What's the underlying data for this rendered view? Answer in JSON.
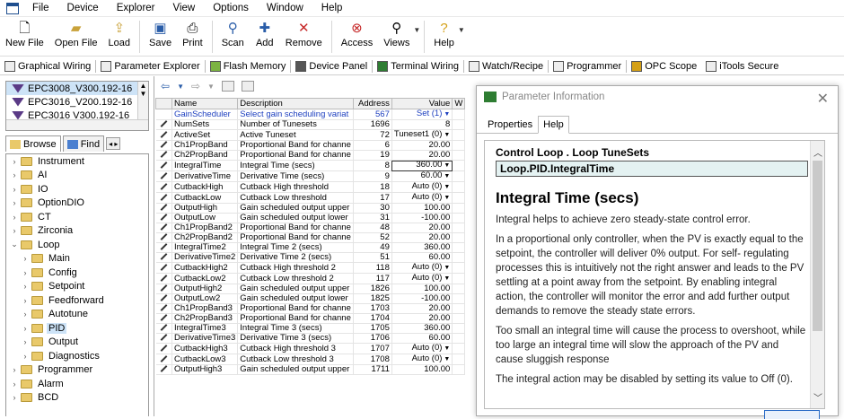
{
  "menu": {
    "items": [
      "File",
      "Device",
      "Explorer",
      "View",
      "Options",
      "Window",
      "Help"
    ]
  },
  "toolbar": {
    "new_file": "New File",
    "open_file": "Open File",
    "load": "Load",
    "save": "Save",
    "print": "Print",
    "scan": "Scan",
    "add": "Add",
    "remove": "Remove",
    "access": "Access",
    "views": "Views",
    "help": "Help"
  },
  "subtoolbar": {
    "items": [
      "Graphical Wiring",
      "Parameter Explorer",
      "Flash Memory",
      "Device Panel",
      "Terminal Wiring",
      "Watch/Recipe",
      "Programmer",
      "OPC Scope",
      "iTools Secure"
    ]
  },
  "devices": [
    "EPC3008_V300.192-16",
    "EPC3016_V200.192-16",
    "EPC3016 V300.192-16"
  ],
  "tabs": {
    "browse": "Browse",
    "find": "Find"
  },
  "tree": [
    {
      "label": "Instrument",
      "indent": 0,
      "expanded": false
    },
    {
      "label": "AI",
      "indent": 0,
      "expanded": false
    },
    {
      "label": "IO",
      "indent": 0,
      "expanded": false
    },
    {
      "label": "OptionDIO",
      "indent": 0,
      "expanded": false
    },
    {
      "label": "CT",
      "indent": 0,
      "expanded": false
    },
    {
      "label": "Zirconia",
      "indent": 0,
      "expanded": false
    },
    {
      "label": "Loop",
      "indent": 0,
      "expanded": true
    },
    {
      "label": "Main",
      "indent": 1,
      "expanded": false
    },
    {
      "label": "Config",
      "indent": 1,
      "expanded": false
    },
    {
      "label": "Setpoint",
      "indent": 1,
      "expanded": false
    },
    {
      "label": "Feedforward",
      "indent": 1,
      "expanded": false
    },
    {
      "label": "Autotune",
      "indent": 1,
      "expanded": false
    },
    {
      "label": "PID",
      "indent": 1,
      "expanded": false,
      "selected": true
    },
    {
      "label": "Output",
      "indent": 1,
      "expanded": false
    },
    {
      "label": "Diagnostics",
      "indent": 1,
      "expanded": false
    },
    {
      "label": "Programmer",
      "indent": 0,
      "expanded": false
    },
    {
      "label": "Alarm",
      "indent": 0,
      "expanded": false
    },
    {
      "label": "BCD",
      "indent": 0,
      "expanded": false
    }
  ],
  "table": {
    "headers": [
      "Name",
      "Description",
      "Address",
      "Value",
      "W"
    ],
    "rows": [
      [
        "GainScheduler",
        "Select gain scheduling variat",
        "567",
        "Set (1)"
      ],
      [
        "NumSets",
        "Number of Tunesets",
        "1696",
        "8"
      ],
      [
        "ActiveSet",
        "Active Tuneset",
        "72",
        "Tuneset1 (0)"
      ],
      [
        "Ch1PropBand",
        "Proportional Band for channe",
        "6",
        "20.00"
      ],
      [
        "Ch2PropBand",
        "Proportional Band for channe",
        "19",
        "20.00"
      ],
      [
        "IntegralTime",
        "Integral Time (secs)",
        "8",
        "360.00"
      ],
      [
        "DerivativeTime",
        "Derivative Time (secs)",
        "9",
        "60.00"
      ],
      [
        "CutbackHigh",
        "Cutback High threshold",
        "18",
        "Auto (0)"
      ],
      [
        "CutbackLow",
        "Cutback Low threshold",
        "17",
        "Auto (0)"
      ],
      [
        "OutputHigh",
        "Gain scheduled output upper",
        "30",
        "100.00"
      ],
      [
        "OutputLow",
        "Gain scheduled output lower",
        "31",
        "-100.00"
      ],
      [
        "Ch1PropBand2",
        "Proportional Band for channe",
        "48",
        "20.00"
      ],
      [
        "Ch2PropBand2",
        "Proportional Band for channe",
        "52",
        "20.00"
      ],
      [
        "IntegralTime2",
        "Integral Time 2 (secs)",
        "49",
        "360.00"
      ],
      [
        "DerivativeTime2",
        "Derivative Time 2 (secs)",
        "51",
        "60.00"
      ],
      [
        "CutbackHigh2",
        "Cutback High threshold 2",
        "118",
        "Auto (0)"
      ],
      [
        "CutbackLow2",
        "Cutback Low threshold 2",
        "117",
        "Auto (0)"
      ],
      [
        "OutputHigh2",
        "Gain scheduled output upper",
        "1826",
        "100.00"
      ],
      [
        "OutputLow2",
        "Gain scheduled output lower",
        "1825",
        "-100.00"
      ],
      [
        "Ch1PropBand3",
        "Proportional Band for channe",
        "1703",
        "20.00"
      ],
      [
        "Ch2PropBand3",
        "Proportional Band for channe",
        "1704",
        "20.00"
      ],
      [
        "IntegralTime3",
        "Integral Time 3 (secs)",
        "1705",
        "360.00"
      ],
      [
        "DerivativeTime3",
        "Derivative Time 3 (secs)",
        "1706",
        "60.00"
      ],
      [
        "CutbackHigh3",
        "Cutback High threshold 3",
        "1707",
        "Auto (0)"
      ],
      [
        "CutbackLow3",
        "Cutback Low threshold 3",
        "1708",
        "Auto (0)"
      ],
      [
        "OutputHigh3",
        "Gain scheduled output upper",
        "1711",
        "100.00"
      ]
    ],
    "dropdown_rows": [
      0,
      2,
      5,
      6,
      7,
      8,
      15,
      16,
      23,
      24
    ]
  },
  "dialog": {
    "title": "Parameter Information",
    "tabs": [
      "Properties",
      "Help"
    ],
    "breadcrumb": "Control Loop . Loop TuneSets",
    "path": "Loop.PID.IntegralTime",
    "heading": "Integral Time (secs)",
    "paragraphs": [
      "Integral helps to achieve zero steady-state control error.",
      "In a proportional only controller, when the PV is exactly equal to the setpoint, the controller will deliver 0% output. For self- regulating processes this is intuitively not the right answer and leads to the PV settling at a point away from the setpoint. By enabling integral action, the controller will monitor the error and add further output demands to remove the steady state errors.",
      "Too small an integral time will cause the process to overshoot, while too large an integral time will slow the approach of the PV and cause sluggish response",
      "The integral action may be disabled by setting its value to Off (0)."
    ]
  },
  "colors": {
    "selection": "#cde3f7",
    "gain_row_text": "#1d3fbf",
    "dialog_icon": "#2e7d32"
  }
}
